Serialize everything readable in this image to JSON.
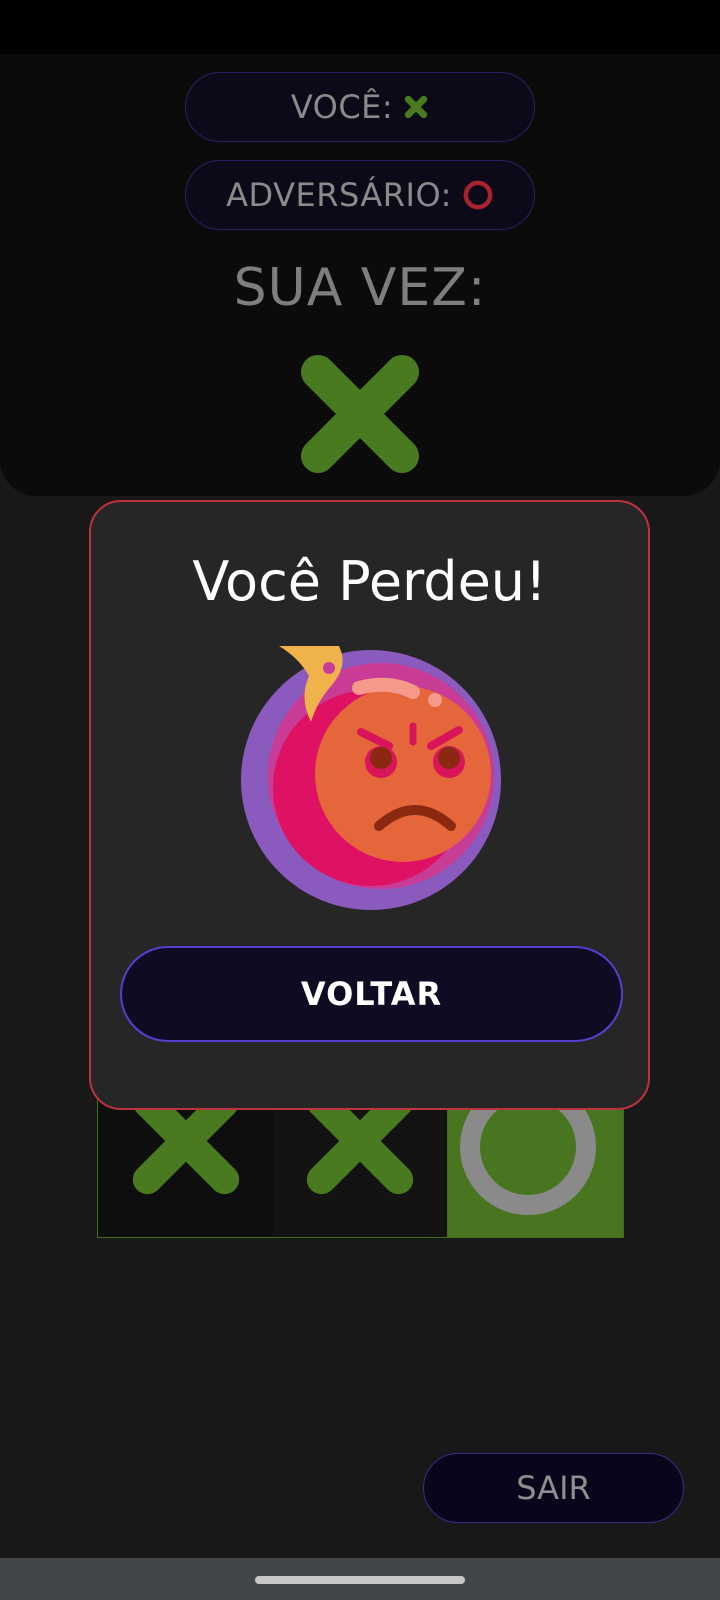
{
  "header": {
    "you_label": "VOCÊ:",
    "opponent_label": "ADVERSÁRIO:",
    "turn_label": "SUA VEZ:"
  },
  "board": {
    "cells": [
      "X",
      "X",
      "O"
    ]
  },
  "modal": {
    "title": "Você Perdeu!",
    "emoji": "angry-face-icon",
    "back_label": "VOLTAR"
  },
  "footer": {
    "exit_label": "SAIR"
  },
  "colors": {
    "x_green": "#4a7a1f",
    "o_red": "#a8232f",
    "modal_border": "#c0313f",
    "button_border": "#5b3cd0",
    "winning_cell": "#4a7520"
  }
}
